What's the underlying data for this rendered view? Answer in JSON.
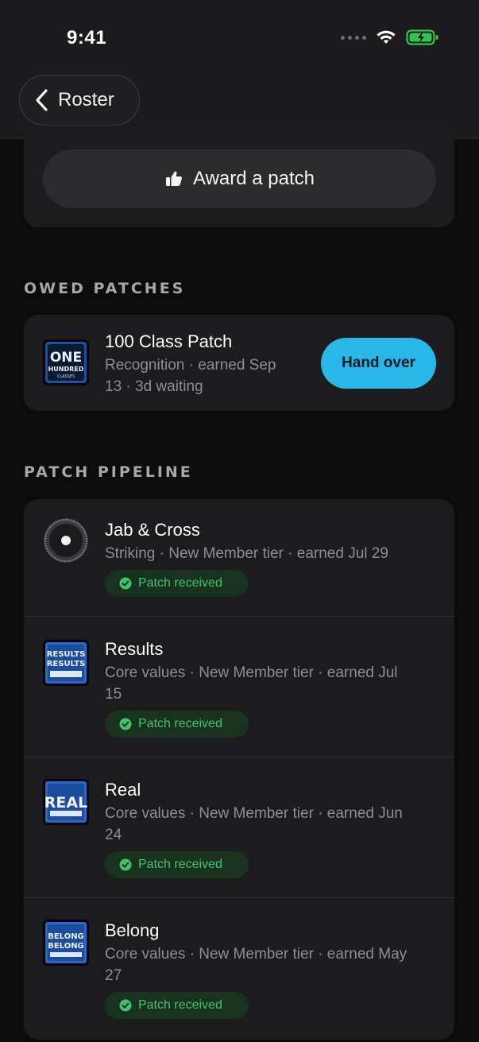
{
  "status_bar": {
    "time": "9:41"
  },
  "nav": {
    "back_label": "Roster"
  },
  "award": {
    "label": "Award a patch"
  },
  "owed": {
    "section_title": "OWED PATCHES",
    "items": [
      {
        "title": "100 Class Patch",
        "meta_line1": "Recognition · earned Sep",
        "meta_line2": "13 · 3d waiting",
        "action_label": "Hand over",
        "thumb_text_1": "ONE",
        "thumb_text_2": "HUNDRED",
        "thumb_text_3": "CLASSES"
      }
    ]
  },
  "pipeline": {
    "section_title": "PATCH PIPELINE",
    "status_label": "Patch received",
    "items": [
      {
        "title": "Jab & Cross",
        "meta_line1": "Striking · New Member tier · earned Jul 29",
        "meta_line2": ""
      },
      {
        "title": "Results",
        "meta_line1": "Core values · New Member tier · earned Jul",
        "meta_line2": "15",
        "thumb_text": "RESULTS"
      },
      {
        "title": "Real",
        "meta_line1": "Core values · New Member tier · earned Jun",
        "meta_line2": "24",
        "thumb_text": "REAL"
      },
      {
        "title": "Belong",
        "meta_line1": "Core values · New Member tier · earned May",
        "meta_line2": "27",
        "thumb_text": "BELONG"
      }
    ]
  },
  "colors": {
    "accent_button": "#29b7e8",
    "success": "#3fc46a",
    "success_bg": "#17331f",
    "background": "#0c0c0d",
    "card": "#1c1c1e"
  },
  "icons": {
    "back": "chevron-left-icon",
    "award": "thumbs-up-icon",
    "check": "check-badge-icon",
    "wifi": "wifi-icon",
    "battery": "battery-charging-icon",
    "signal": "signal-dots-icon"
  }
}
